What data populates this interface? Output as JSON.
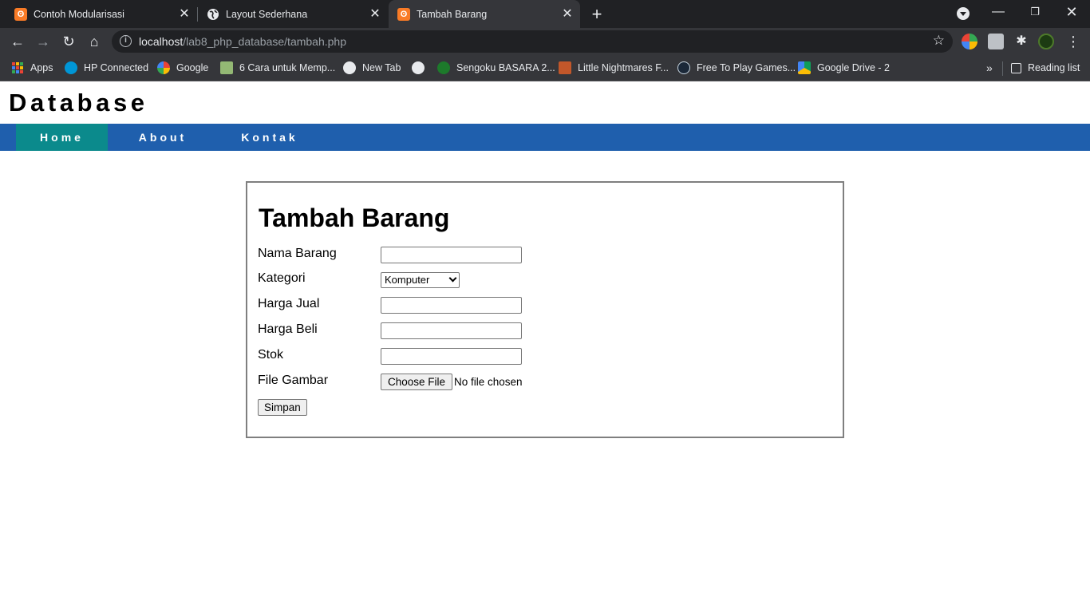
{
  "browser": {
    "tabs": [
      {
        "title": "Contoh Modularisasi",
        "icon": "xampp-icon",
        "active": false
      },
      {
        "title": "Layout Sederhana",
        "icon": "globe-icon",
        "active": false
      },
      {
        "title": "Tambah Barang",
        "icon": "xampp-icon",
        "active": true
      }
    ],
    "address": {
      "host": "localhost",
      "path": "/lab8_php_database/tambah.php"
    },
    "bookmarks": [
      {
        "label": "Apps",
        "icon": "apps-grid-icon"
      },
      {
        "label": "HP Connected",
        "icon": "hp-icon"
      },
      {
        "label": "Google",
        "icon": "google-icon"
      },
      {
        "label": "6 Cara untuk Memp...",
        "icon": "wikihow-icon"
      },
      {
        "label": "New Tab",
        "icon": "globe-icon"
      },
      {
        "label": "",
        "icon": "globe-icon"
      },
      {
        "label": "Sengoku BASARA 2...",
        "icon": "game-icon"
      },
      {
        "label": "Little Nightmares F...",
        "icon": "folder-game-icon"
      },
      {
        "label": "Free To Play Games...",
        "icon": "steam-icon"
      },
      {
        "label": "Google Drive - 2",
        "icon": "google-drive-icon"
      }
    ],
    "overflow_label": "»",
    "reading_list": "Reading list"
  },
  "site": {
    "title": "Database",
    "nav": [
      {
        "label": "Home",
        "active": true
      },
      {
        "label": "About",
        "active": false
      },
      {
        "label": "Kontak",
        "active": false
      }
    ],
    "accent_nav": "#1f5fad",
    "accent_active": "#0b8a8c"
  },
  "form": {
    "heading": "Tambah Barang",
    "fields": {
      "nama_barang": {
        "label": "Nama Barang",
        "value": ""
      },
      "kategori": {
        "label": "Kategori",
        "value": "Komputer"
      },
      "harga_jual": {
        "label": "Harga Jual",
        "value": ""
      },
      "harga_beli": {
        "label": "Harga Beli",
        "value": ""
      },
      "stok": {
        "label": "Stok",
        "value": ""
      },
      "file_gambar": {
        "label": "File Gambar",
        "button": "Choose File",
        "status": "No file chosen"
      }
    },
    "submit": "Simpan"
  }
}
